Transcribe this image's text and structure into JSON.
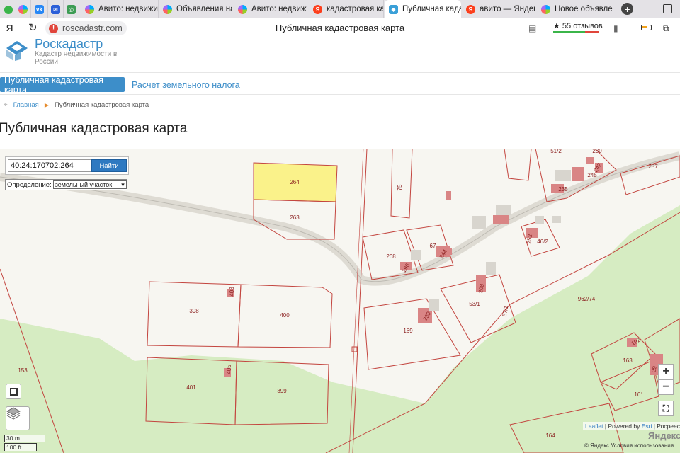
{
  "browser": {
    "tabs": [
      {
        "label": "",
        "icon": "avito-icon"
      },
      {
        "label": "",
        "icon": "vk-icon"
      },
      {
        "label": "",
        "icon": "mail-icon"
      },
      {
        "label": "",
        "icon": "green-icon"
      },
      {
        "label": "Авито: недвижи",
        "icon": "avito-icon"
      },
      {
        "label": "Объявления на ",
        "icon": "avito-icon"
      },
      {
        "label": "Авито: недвижи",
        "icon": "avito-icon"
      },
      {
        "label": "кадастровая ка",
        "icon": "yandex-icon"
      },
      {
        "label": "Публичная када",
        "icon": "rosreestr-icon",
        "active": true
      },
      {
        "label": "авито — Яндекс",
        "icon": "yandex-icon"
      },
      {
        "label": "Новое объявлен",
        "icon": "avito-icon"
      }
    ],
    "url": "roscadastr.com",
    "page_title": "Публичная кадастровая карта",
    "reviews": "★ 55 отзывов",
    "ya_button": "Я"
  },
  "site": {
    "brand": "Роскадастр",
    "brand_sub": "Кадастр недвижимости в России",
    "nav": {
      "map": "Публичная кадастровая карта",
      "tax": "Расчет земельного налога"
    },
    "breadcrumb": {
      "home": "Главная",
      "current": "Публичная кадастровая карта"
    },
    "heading": "Публичная кадастровая карта"
  },
  "map": {
    "search": {
      "value": "40:24:170702:264",
      "button": "Найти"
    },
    "definition": {
      "label": "Определение:",
      "selected": "земельный участок"
    },
    "parcel_labels": [
      "264",
      "263",
      "75",
      "268",
      "196",
      "67",
      "244",
      "252",
      "46/2",
      "51/2",
      "230",
      "242",
      "245",
      "235",
      "237",
      "398",
      "403",
      "400",
      "169",
      "239",
      "53/1",
      "208",
      "57/1",
      "962/74",
      "153",
      "401",
      "405",
      "399",
      "163",
      "192",
      "29",
      "161",
      "164"
    ],
    "zoom_in": "+",
    "zoom_out": "−",
    "scale": {
      "metric": "30 m",
      "imperial": "100 ft"
    },
    "attribution": {
      "leaflet": "Leaflet",
      "powered": " | Powered by ",
      "esri": "Esri",
      "rest": " | Росреестр"
    },
    "yandex": "Яндекс",
    "terms": "© Яндекс  Условия использования",
    "colors": {
      "highlight": "#faf28a",
      "parcel_stroke": "#c3453f",
      "green_area": "#d6ecc2",
      "building": "#d98585"
    }
  }
}
